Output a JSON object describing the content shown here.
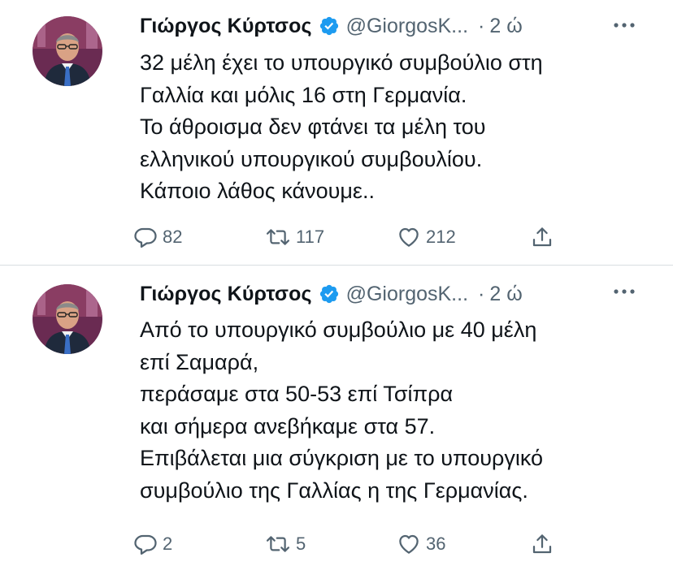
{
  "tweets": [
    {
      "author": {
        "name": "Γιώργος Κύρτσος",
        "handle": "@GiorgosK...",
        "verified": true
      },
      "separator": "·",
      "time": "2 ώ",
      "text_lines": [
        "32 μέλη έχει το υπουργικό συμβούλιο στη",
        "Γαλλία και μόλις 16 στη Γερμανία.",
        "Το άθροισμα δεν φτάνει τα μέλη του",
        "ελληνικού υπουργικού συμβουλίου.",
        "Κάποιο λάθος κάνουμε.."
      ],
      "stats": {
        "replies": "82",
        "retweets": "117",
        "likes": "212"
      }
    },
    {
      "author": {
        "name": "Γιώργος Κύρτσος",
        "handle": "@GiorgosK...",
        "verified": true
      },
      "separator": "·",
      "time": "2 ώ",
      "text_lines": [
        "Από το υπουργικό συμβούλιο με 40 μέλη",
        "επί Σαμαρά,",
        "περάσαμε στα 50-53 επί Τσίπρα",
        "και σήμερα ανεβήκαμε στα 57.",
        "Επιβάλεται μια σύγκριση με το υπουργικό",
        "συμβούλιο της Γαλλίας η της Γερμανίας."
      ],
      "stats": {
        "replies": "2",
        "retweets": "5",
        "likes": "36"
      }
    }
  ],
  "icons": {
    "verified": "verified-badge-icon",
    "more": "more-options-icon",
    "reply": "reply-icon",
    "retweet": "retweet-icon",
    "like": "like-icon",
    "share": "share-icon"
  },
  "colors": {
    "text_primary": "#0f1419",
    "text_secondary": "#536471",
    "verified_blue": "#1d9bf0",
    "background": "#ffffff",
    "divider": "#d9dde1"
  }
}
